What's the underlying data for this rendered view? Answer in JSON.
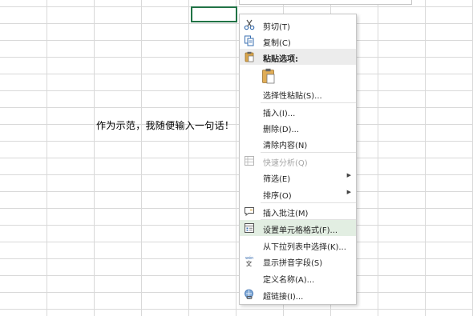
{
  "sheet": {
    "cell_text": "作为示范，我随便输入一句话！"
  },
  "context_menu": {
    "cut": "剪切(T)",
    "copy": "复制(C)",
    "paste_options": "粘贴选项:",
    "paste_special": "选择性粘贴(S)...",
    "insert": "插入(I)...",
    "delete": "删除(D)...",
    "clear_contents": "清除内容(N)",
    "quick_analysis": "快速分析(Q)",
    "filter": "筛选(E)",
    "sort": "排序(O)",
    "insert_comment": "插入批注(M)",
    "format_cells": "设置单元格格式(F)...",
    "pick_from_list": "从下拉列表中选择(K)...",
    "show_phonetic": "显示拼音字段(S)",
    "define_name": "定义名称(A)...",
    "hyperlink": "超链接(I)..."
  },
  "icons": {
    "cut": "scissors-icon",
    "copy": "copy-icon",
    "paste": "clipboard-icon",
    "quick_analysis": "quick-analysis-icon",
    "comment": "comment-icon",
    "format": "format-cells-icon",
    "phonetic": "phonetic-icon",
    "hyperlink": "hyperlink-icon"
  },
  "colors": {
    "accent_green": "#217346",
    "highlight": "#e2eee2",
    "grid": "#d9d9d9"
  }
}
